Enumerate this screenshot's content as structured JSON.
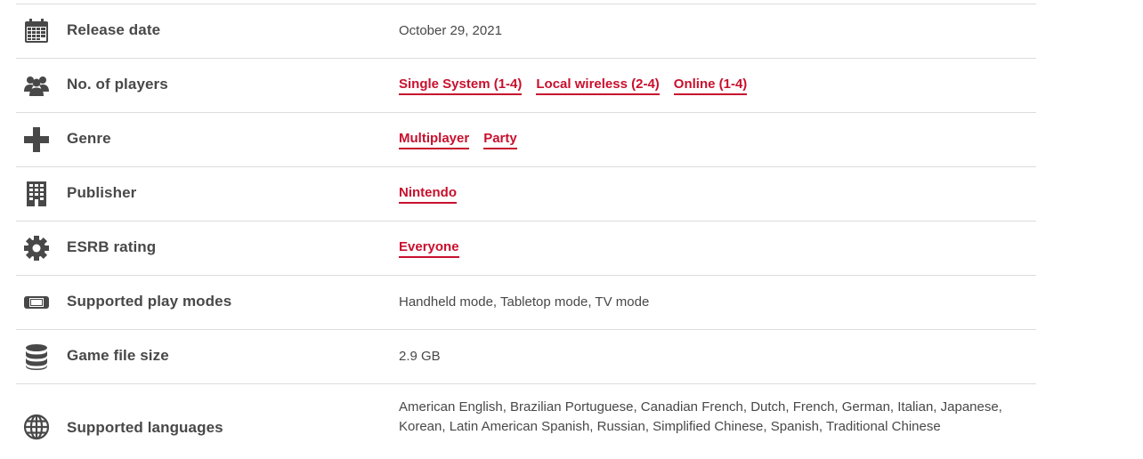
{
  "colors": {
    "text": "#484848",
    "link": "#c8102e",
    "divider": "#dcdcdc",
    "icon": "#484848"
  },
  "rows": [
    {
      "icon": "calendar-icon",
      "label": "Release date",
      "value": "October 29, 2021"
    },
    {
      "icon": "players-icon",
      "label": "No. of players",
      "links": [
        "Single System (1-4)",
        "Local wireless (2-4)",
        "Online (1-4)"
      ]
    },
    {
      "icon": "dpad-icon",
      "label": "Genre",
      "links": [
        "Multiplayer",
        "Party"
      ]
    },
    {
      "icon": "building-icon",
      "label": "Publisher",
      "links": [
        "Nintendo"
      ]
    },
    {
      "icon": "gear-icon",
      "label": "ESRB rating",
      "links": [
        "Everyone"
      ]
    },
    {
      "icon": "switch-console-icon",
      "label": "Supported play modes",
      "value": "Handheld mode, Tabletop mode, TV mode"
    },
    {
      "icon": "database-icon",
      "label": "Game file size",
      "value": "2.9 GB"
    },
    {
      "icon": "globe-icon",
      "label": "Supported languages",
      "value": "American English, Brazilian Portuguese, Canadian French, Dutch, French, German, Italian, Japanese, Korean, Latin American Spanish, Russian, Simplified Chinese, Spanish, Traditional Chinese"
    }
  ]
}
